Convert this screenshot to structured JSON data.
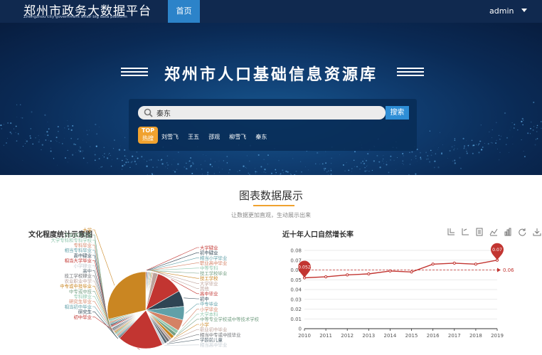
{
  "header": {
    "logo_title": "郑州市政务大数据平台",
    "logo_subtitle": "Zhengzhou city government affair big data platform",
    "nav_home": "首页",
    "user_name": "admin",
    "colors": {
      "bar": "#10294f",
      "nav_active": "#2c83c9"
    }
  },
  "hero": {
    "title": "郑州市人口基础信息资源库",
    "search": {
      "value": "秦东",
      "button_label": "搜索"
    },
    "hot_badge": {
      "line1": "TOP",
      "line2": "热搜"
    },
    "hot_terms": [
      "刘雪飞",
      "王五",
      "邵观",
      "柳雪飞",
      "秦东"
    ]
  },
  "section": {
    "title": "图表数据展示",
    "subtitle": "让数据更加直观，生动展示出来"
  },
  "pie_panel": {
    "title": "文化程度统计示意图"
  },
  "line_panel": {
    "title": "近十年人口自然增长率",
    "toolbox_icons": [
      "zoom-icon",
      "zoom-reset-icon",
      "data-view-icon",
      "line-chart-icon",
      "bar-chart-icon",
      "restore-icon",
      "download-icon"
    ]
  },
  "chart_data": [
    {
      "type": "pie",
      "title": "文化程度统计示意图",
      "slices": [
        {
          "name": "大学肄业",
          "value": 0.4,
          "color": "#c23531"
        },
        {
          "name": "初中肄业",
          "value": 0.4,
          "color": "#2f4554"
        },
        {
          "name": "相当小学毕业",
          "value": 0.4,
          "color": "#61a0a8"
        },
        {
          "name": "职业高中毕业",
          "value": 0.4,
          "color": "#d48265"
        },
        {
          "name": "中等专科",
          "value": 0.4,
          "color": "#91c7ae"
        },
        {
          "name": "技工学校毕业",
          "value": 0.4,
          "color": "#749f83"
        },
        {
          "name": "技工学校",
          "value": 0.4,
          "color": "#ca8622"
        },
        {
          "name": "大学毕业",
          "value": 0.4,
          "color": "#bda29a"
        },
        {
          "name": "其他",
          "value": 2.2,
          "color": "#bda29a"
        },
        {
          "name": "高中毕业",
          "value": 12,
          "color": "#c23531"
        },
        {
          "name": "初中",
          "value": 7,
          "color": "#2f4554"
        },
        {
          "name": "中专毕业",
          "value": 6,
          "color": "#61a0a8"
        },
        {
          "name": "小学毕业",
          "value": 5,
          "color": "#d48265"
        },
        {
          "name": "大学本科",
          "value": 1.5,
          "color": "#91c7ae"
        },
        {
          "name": "中等专业学校或中等技术学校",
          "value": 1.5,
          "color": "#749f83"
        },
        {
          "name": "小学",
          "value": 1.5,
          "color": "#ca8622"
        },
        {
          "name": "职业初中毕业",
          "value": 1.2,
          "color": "#bda29a"
        },
        {
          "name": "相当中专或中技毕业",
          "value": 1.2,
          "color": "#6e7074"
        },
        {
          "name": "学龄前儿童",
          "value": 1.2,
          "color": "#546570"
        },
        {
          "name": "相当高中毕业",
          "value": 1.2,
          "color": "#c4ccd3"
        },
        {
          "name": "初中毕业",
          "value": 20,
          "color": "#c23531"
        },
        {
          "name": "研究生",
          "value": 0.6,
          "color": "#2f4554"
        },
        {
          "name": "相当初中毕业",
          "value": 0.6,
          "color": "#61a0a8"
        },
        {
          "name": "研究生毕业",
          "value": 0.6,
          "color": "#d48265"
        },
        {
          "name": "专科肄业",
          "value": 0.6,
          "color": "#91c7ae"
        },
        {
          "name": "中专或中技",
          "value": 0.6,
          "color": "#749f83"
        },
        {
          "name": "中专或中技毕业",
          "value": 0.6,
          "color": "#ca8622"
        },
        {
          "name": "农业职业中学",
          "value": 0.6,
          "color": "#bda29a"
        },
        {
          "name": "技工学校肄业",
          "value": 0.6,
          "color": "#6e7074"
        },
        {
          "name": "高中",
          "value": 0.6,
          "color": "#546570"
        },
        {
          "name": "小学肄业",
          "value": 0.6,
          "color": "#c4ccd3"
        },
        {
          "name": "相当大学毕业",
          "value": 0.6,
          "color": "#c23531"
        },
        {
          "name": "高中肄业",
          "value": 0.6,
          "color": "#2f4554"
        },
        {
          "name": "相当专科毕业",
          "value": 0.6,
          "color": "#61a0a8"
        },
        {
          "name": "专科毕业",
          "value": 0.6,
          "color": "#d48265"
        },
        {
          "name": "大学专科和专科学校",
          "value": 0.6,
          "color": "#91c7ae"
        },
        {
          "name": "文盲或半文盲",
          "value": 0.6,
          "color": "#749f83"
        },
        {
          "name": "大学",
          "value": 30,
          "color": "#ca8622"
        }
      ]
    },
    {
      "type": "line",
      "title": "近十年人口自然增长率",
      "x": [
        "2010",
        "2011",
        "2012",
        "2013",
        "2014",
        "2015",
        "2016",
        "2017",
        "2018",
        "2019"
      ],
      "values": [
        0.052,
        0.053,
        0.055,
        0.056,
        0.059,
        0.058,
        0.066,
        0.067,
        0.066,
        0.07
      ],
      "ylim": [
        0,
        0.08
      ],
      "yticks": [
        "0",
        "0.01",
        "0.02",
        "0.03",
        "0.04",
        "0.05",
        "0.06",
        "0.07",
        "0.08"
      ],
      "average": 0.06,
      "average_label": "0.06",
      "min_label": "0.052",
      "max_label": "0.07",
      "color": "#c23531",
      "grid": true
    }
  ]
}
